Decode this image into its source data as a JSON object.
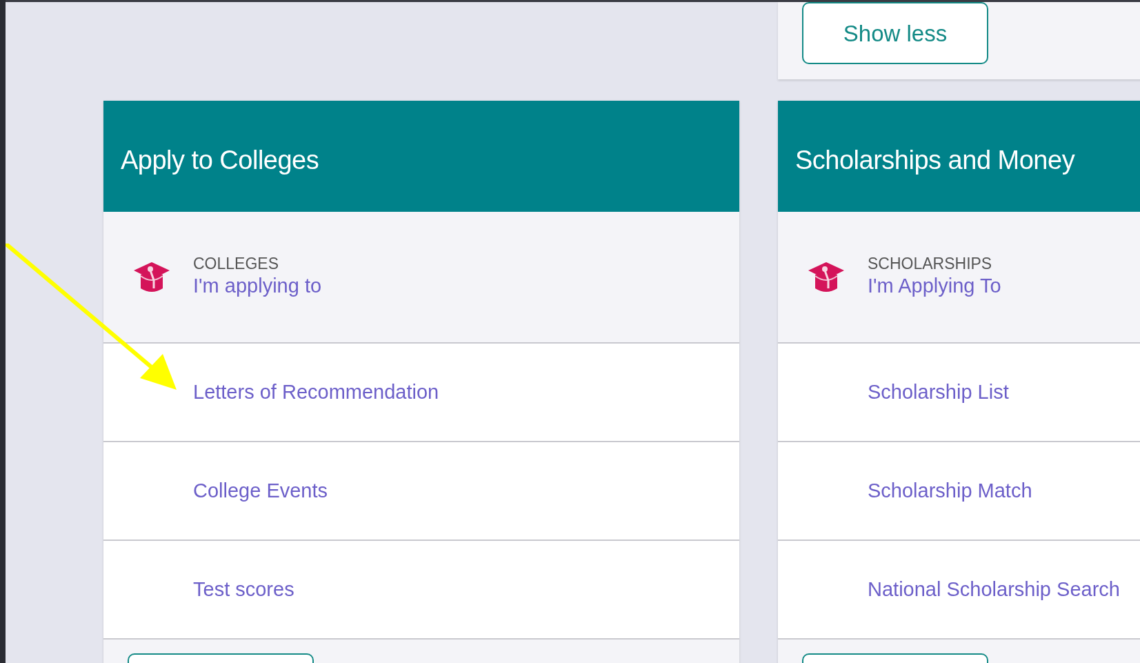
{
  "top_card": {
    "button": "Show less"
  },
  "cards": [
    {
      "title": "Apply to Colleges",
      "featured": {
        "category": "COLLEGES",
        "link": "I'm applying to"
      },
      "links": [
        "Letters of Recommendation",
        "College Events",
        "Test scores"
      ]
    },
    {
      "title": "Scholarships and Money",
      "featured": {
        "category": "SCHOLARSHIPS",
        "link": "I'm Applying To"
      },
      "links": [
        "Scholarship List",
        "Scholarship Match",
        "National Scholarship Search"
      ]
    }
  ]
}
